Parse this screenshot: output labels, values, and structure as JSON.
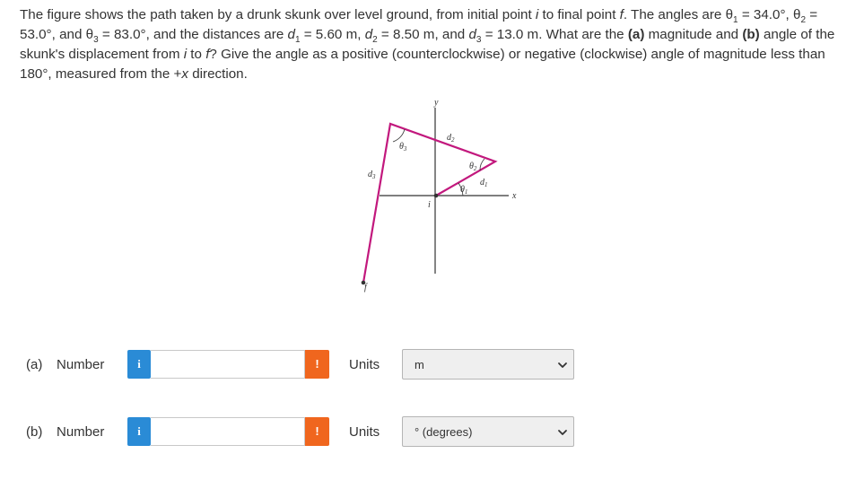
{
  "question": {
    "intro": "The figure shows the path taken by a drunk skunk over level ground, from initial point ",
    "i": "i",
    "to_final": " to final point ",
    "f": "f",
    "angles_are": ". The angles are ",
    "theta": "θ",
    "sub1": "1",
    "sub2": "2",
    "sub3": "3",
    "theta1_val": " = 34.0°,",
    "theta2_val": " = 53.0°, and ",
    "theta3_val": " = 83.0°, and the distances are ",
    "d": "d",
    "d1_val": " = 5.60 m, ",
    "d2_val": " = 8.50 m, and ",
    "d3_val": " = 13.0 m. What are the ",
    "part_a": "(a)",
    "magnitude_and": " magnitude and ",
    "part_b": "(b)",
    "angle_of": " angle of the skunk's displacement from ",
    "to": " to ",
    "give_angle": "? Give the angle as a positive (counterclockwise) or negative (clockwise) angle of magnitude less than 180°, measured from the +",
    "x": "x",
    "direction": " direction."
  },
  "figure": {
    "y_label": "y",
    "x_label": "x",
    "i_label": "i",
    "f_label": "f",
    "d": "d",
    "theta": "θ",
    "sub1": "1",
    "sub2": "2",
    "sub3": "3",
    "path_color": "#c2187d"
  },
  "rows": [
    {
      "part": "(a)",
      "number_label": "Number",
      "info_icon": "i",
      "input_value": "",
      "warning_icon": "!",
      "units_label": "Units",
      "units_value": "m"
    },
    {
      "part": "(b)",
      "number_label": "Number",
      "info_icon": "i",
      "input_value": "",
      "warning_icon": "!",
      "units_label": "Units",
      "units_value": "° (degrees)"
    }
  ],
  "colors": {
    "info": "#2a8bd6",
    "warning": "#f0661e"
  }
}
